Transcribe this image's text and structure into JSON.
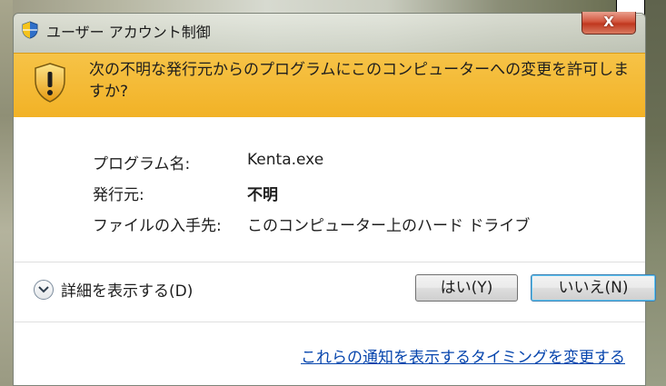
{
  "window": {
    "title": "ユーザー アカウント制御",
    "close_label": "X"
  },
  "warning": {
    "message": "次の不明な発行元からのプログラムにこのコンピューターへの変更を許可しますか?"
  },
  "info": {
    "rows": [
      {
        "label": "プログラム名:",
        "value": "Kenta.exe"
      },
      {
        "label": "発行元:",
        "value": "不明"
      },
      {
        "label": "ファイルの入手先:",
        "value": "このコンピューター上のハード ドライブ"
      }
    ]
  },
  "details_toggle": {
    "label": "詳細を表示する(D)"
  },
  "buttons": {
    "yes": "はい(Y)",
    "no": "いいえ(N)"
  },
  "footer_link": {
    "label": "これらの通知を表示するタイミングを変更する"
  },
  "colors": {
    "warning_band": "#f2b226",
    "link": "#0645ad",
    "close_button": "#c0381f"
  }
}
